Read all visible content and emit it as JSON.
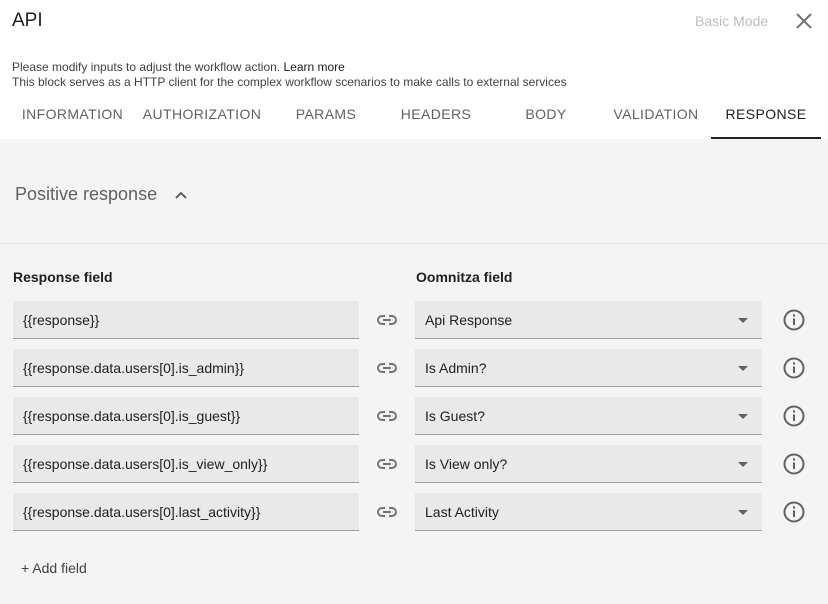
{
  "header": {
    "title": "API",
    "basic_mode_label": "Basic Mode",
    "close_icon": "close-icon"
  },
  "description": {
    "line1_text": "Please modify inputs to adjust the workflow action. ",
    "learn_more": "Learn more",
    "line2": "This block serves as a HTTP client for the complex workflow scenarios to make calls to external services"
  },
  "tabs": [
    {
      "label": "INFORMATION"
    },
    {
      "label": "AUTHORIZATION"
    },
    {
      "label": "PARAMS"
    },
    {
      "label": "HEADERS"
    },
    {
      "label": "BODY"
    },
    {
      "label": "VALIDATION"
    },
    {
      "label": "RESPONSE"
    }
  ],
  "active_tab": "RESPONSE",
  "section": {
    "title": "Positive response",
    "toggle_icon": "chevron-up-icon"
  },
  "columns": {
    "response_field": "Response field",
    "oomnitza_field": "Oomnitza field"
  },
  "mappings": [
    {
      "response": "{{response}}",
      "field": "Api Response"
    },
    {
      "response": "{{response.data.users[0].is_admin}}",
      "field": "Is Admin?"
    },
    {
      "response": "{{response.data.users[0].is_guest}}",
      "field": "Is Guest?"
    },
    {
      "response": "{{response.data.users[0].is_view_only}}",
      "field": "Is View only?"
    },
    {
      "response": "{{response.data.users[0].last_activity}}",
      "field": "Last Activity"
    }
  ],
  "add_field_label": "+ Add field",
  "colors": {
    "content_bg": "#f4f4f4",
    "input_bg": "#e9e9e9",
    "active_tab": "#212121",
    "muted_text": "#bdbdbd"
  }
}
